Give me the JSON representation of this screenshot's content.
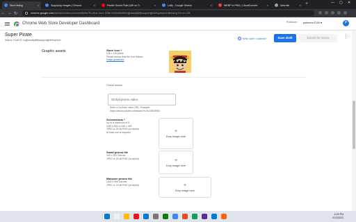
{
  "browser": {
    "tabs": [
      {
        "title": "Store listing",
        "favicon_color": "#4285f4",
        "active": true
      },
      {
        "title": "Supplying Images | Chrome",
        "favicon_color": "#4285f4",
        "active": false
      },
      {
        "title": "Pacific Grand Fluid (Offl vs Tr",
        "favicon_color": "#ff0000",
        "active": false
      },
      {
        "title": "Luffy - Google Search",
        "favicon_color": "#4285f4",
        "active": false
      },
      {
        "title": "WEBP to PNG | CloudConvert",
        "favicon_color": "#f44336",
        "active": false
      },
      {
        "title": "New tab",
        "favicon_color": "#9aa0a6",
        "active": false
      }
    ],
    "new_tab_label": "+",
    "url_host": "chrome.google.com",
    "url_path": "/webstore/devconsole/e5b8a7f9-c8ca-4cc1-928e-b09cd9ed5/bojjbasafyklffjsaapphfjjfdbfhqnbdn/edit/listing?hl=en-GB"
  },
  "header": {
    "brand": "Chrome Web Store Developer Dashboard",
    "publisher_label": "Publisher:",
    "publisher_value": "pokemon7100 ▾",
    "avatar_letter": "P"
  },
  "item": {
    "name": "Super Pirate",
    "status": "Status: Draft    ID: bojjbasafyklffjsaapphfjjfdbfhqnbdn"
  },
  "actions": {
    "help_text": "Why can't I submit?",
    "help_icon": "?",
    "save_label": "Save draft",
    "submit_label": "Submit for review",
    "more_icon": "⋮"
  },
  "graphic_assets": {
    "section_title": "Graphic assets",
    "store_icon": {
      "label": "Store Icon *",
      "hints": [
        "128 x 128 pixels",
        "Please ensure that the icon follows"
      ],
      "link": "image guidelines"
    },
    "global_assets_label": "Global assets",
    "promo_video": {
      "placeholder": "Global promo video",
      "hints": [
        "Enter a YouTube video URL. Example:",
        "https://www.youtube.com/watch?v=5243678964"
      ]
    },
    "screenshots": {
      "label": "Screenshots *",
      "hints": [
        "Up to a maximum of 5",
        "1280 x 800 or 640 x 400",
        "JPEG or 24-bit PNG (no alpha)",
        "At least one is required"
      ],
      "drop_text": "Drop image here"
    },
    "small_promo": {
      "label": "Small promo tile",
      "hints": [
        "440 x 280 Canvas",
        "JPEG or 24-bit PNG (no alpha)"
      ],
      "drop_text": "Drop image here"
    },
    "marquee_promo": {
      "label": "Marquee promo tile",
      "hints": [
        "1400 x 560 Canvas",
        "JPEG or 24-bit PNG (no alpha)"
      ],
      "drop_text": "Drop image here"
    },
    "plus_icon": "+"
  },
  "taskbar": {
    "time": "4:29 PM",
    "date": "2/12/2023",
    "colors": [
      "#0078d4",
      "#f3f3f3",
      "#ffb900",
      "#e81123",
      "#0078d4",
      "#7a7574",
      "#107c10",
      "#4285f4",
      "#e44d26",
      "#0f9d58",
      "#5c2d91",
      "#0078d4",
      "#f7630c"
    ]
  }
}
